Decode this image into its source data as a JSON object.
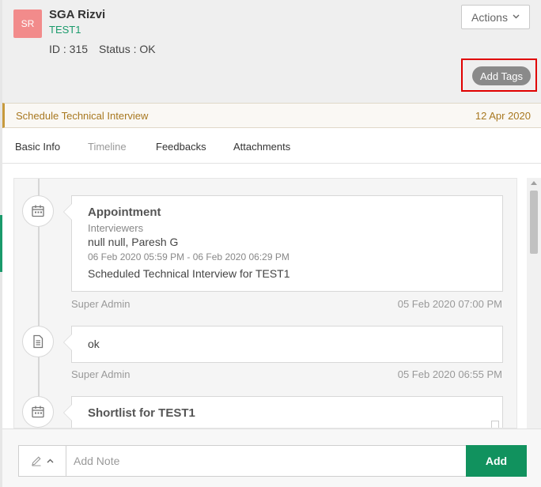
{
  "candidate": {
    "avatar_initials": "SR",
    "name": "SGA Rizvi",
    "subtitle": "TEST1",
    "id_text": "ID : 315",
    "status_text": "Status : OK"
  },
  "header": {
    "actions_label": "Actions",
    "add_tags_label": "Add Tags"
  },
  "schedule": {
    "title": "Schedule Technical Interview",
    "date": "12 Apr 2020"
  },
  "tabs": [
    {
      "label": "Basic Info",
      "active": true
    },
    {
      "label": "Timeline",
      "active": false
    },
    {
      "label": "Feedbacks",
      "active": true
    },
    {
      "label": "Attachments",
      "active": true
    }
  ],
  "timeline": [
    {
      "icon": "calendar-icon",
      "title": "Appointment",
      "label": "Interviewers",
      "line1": "null null,  Paresh G",
      "time": "06 Feb 2020 05:59 PM - 06 Feb 2020 06:29 PM",
      "line2": "Scheduled Technical Interview for TEST1",
      "author": "Super Admin",
      "timestamp": "05 Feb 2020 07:00 PM"
    },
    {
      "icon": "document-icon",
      "text": "ok",
      "author": "Super Admin",
      "timestamp": "05 Feb 2020 06:55 PM"
    },
    {
      "icon": "calendar-icon",
      "title": "Shortlist for TEST1"
    }
  ],
  "note": {
    "placeholder": "Add Note",
    "add_label": "Add"
  },
  "colors": {
    "brand_green": "#11925e",
    "avatar": "#f28b8b",
    "highlight": "#e00000",
    "schedule_text": "#a87820"
  }
}
